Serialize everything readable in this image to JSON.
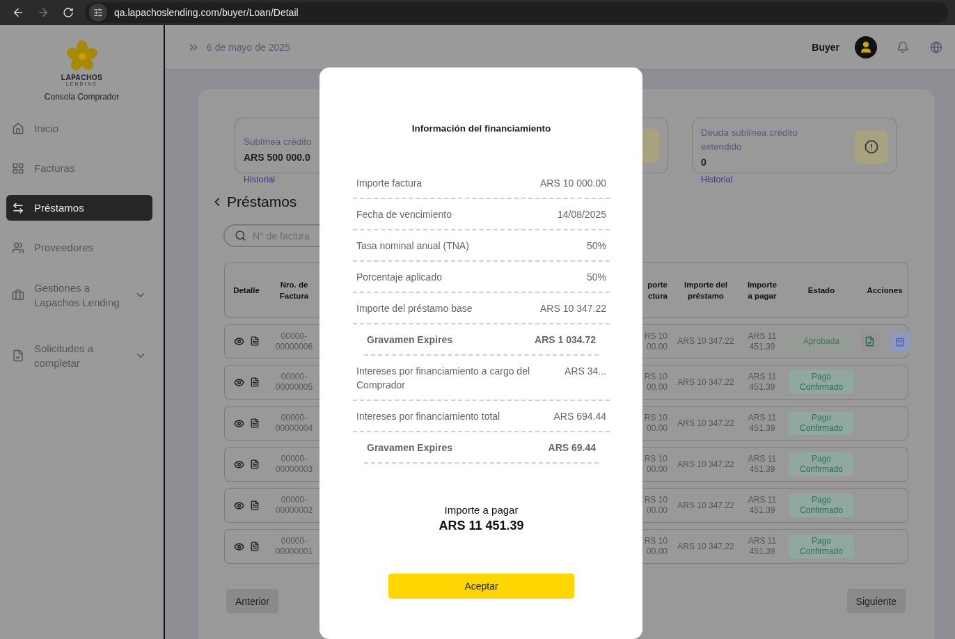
{
  "browser": {
    "url": "qa.lapachoslending.com/buyer/Loan/Detail",
    "forward_disabled": true
  },
  "sidebar": {
    "logo": {
      "name": "LAPACHOS",
      "tagline": "LENDING"
    },
    "subtitle": "Consola Comprador",
    "items": [
      {
        "label": "Inicio",
        "selected": false,
        "expandable": false
      },
      {
        "label": "Facturas",
        "selected": false,
        "expandable": false
      },
      {
        "label": "Préstamos",
        "selected": true,
        "expandable": false
      },
      {
        "label": "Proveedores",
        "selected": false,
        "expandable": false
      },
      {
        "label": "Gestiones a Lapachos Lending",
        "selected": false,
        "expandable": true
      },
      {
        "label": "Solicitudes a completar",
        "selected": false,
        "expandable": true
      }
    ]
  },
  "header": {
    "date": "6 de mayo de 2025",
    "user": "Buyer"
  },
  "cards": {
    "left": {
      "title": "Sublínea crédito",
      "value": "ARS 500 000.0",
      "link": "Historial"
    },
    "right": {
      "title": "Deuda sublínea crédito extendido",
      "value": "0",
      "link": "Historial"
    }
  },
  "page_title": "Préstamos",
  "search": {
    "placeholder": "N° de factura"
  },
  "table": {
    "columns_left": [
      "Detalle",
      "Nro. de Factura"
    ],
    "columns_right": [
      "porte ctura",
      "Importe del préstamo",
      "Importe a pagar",
      "Estado",
      "Acciones"
    ],
    "rows": [
      {
        "invoice": "00000-00000006",
        "column_3": "RS 10 00.00",
        "loan": "ARS 10 347.22",
        "to_pay": "ARS 11 451.39",
        "status": {
          "label": "Aprobada",
          "kind": "approved"
        },
        "actions": true
      },
      {
        "invoice": "00000-00000005",
        "column_3": "RS 10 00.00",
        "loan": "ARS 10 347.22",
        "to_pay": "ARS 11 451.39",
        "status": {
          "label": "Pago Confirmado",
          "kind": "confirmed"
        },
        "actions": false
      },
      {
        "invoice": "00000-00000004",
        "column_3": "RS 10 00.00",
        "loan": "ARS 10 347.22",
        "to_pay": "ARS 11 451.39",
        "status": {
          "label": "Pago Confirmado",
          "kind": "confirmed"
        },
        "actions": false
      },
      {
        "invoice": "00000-00000003",
        "column_3": "RS 10 00.00",
        "loan": "ARS 10 347.22",
        "to_pay": "ARS 11 451.39",
        "status": {
          "label": "Pago Confirmado",
          "kind": "confirmed"
        },
        "actions": false
      },
      {
        "invoice": "00000-00000002",
        "column_3": "RS 10 00.00",
        "loan": "ARS 10 347.22",
        "to_pay": "ARS 11 451.39",
        "status": {
          "label": "Pago Confirmado",
          "kind": "confirmed"
        },
        "actions": false
      },
      {
        "invoice": "00000-00000001",
        "column_3": "RS 10 00.00",
        "loan": "ARS 10 347.22",
        "to_pay": "ARS 11 451.39",
        "status": {
          "label": "Pago Confirmado",
          "kind": "confirmed"
        },
        "actions": false
      }
    ]
  },
  "pagination": {
    "previous": "Anterior",
    "next": "Siguiente"
  },
  "modal": {
    "title": "Información del financiamiento",
    "rows": [
      {
        "kind": "line",
        "label": "Importe factura",
        "value": "ARS 10 000.00"
      },
      {
        "kind": "line",
        "label": "Fecha de vencimiento",
        "value": "14/08/2025"
      },
      {
        "kind": "line",
        "label": "Tasa nominal anual (TNA)",
        "value": "50%"
      },
      {
        "kind": "line",
        "label": "Porcentaje aplicado",
        "value": "50%"
      },
      {
        "kind": "line",
        "label": "Importe del préstamo base",
        "value": "ARS 10 347.22"
      },
      {
        "kind": "sub",
        "label": "Gravamen Expires",
        "value": "ARS 1 034.72"
      },
      {
        "kind": "line",
        "label": "Intereses por financiamiento a cargo del Comprador",
        "value": "ARS 34..."
      },
      {
        "kind": "line",
        "label": "Intereses por financiamiento total",
        "value": "ARS 694.44"
      },
      {
        "kind": "sub",
        "label": "Gravamen Expires",
        "value": "ARS 69.44"
      }
    ],
    "total_label": "Importe a pagar",
    "total_value": "ARS 11 451.39",
    "button": "Aceptar"
  }
}
